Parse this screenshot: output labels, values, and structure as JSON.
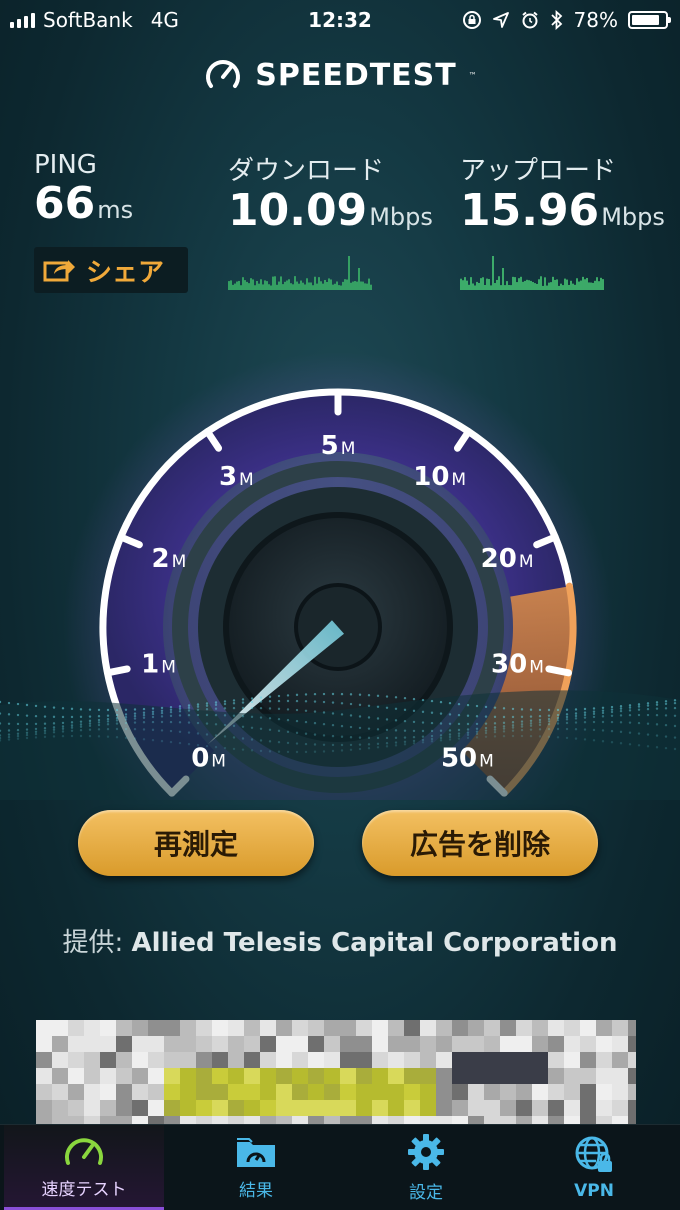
{
  "status_bar": {
    "carrier": "SoftBank",
    "network": "4G",
    "time": "12:32",
    "battery": "78%",
    "battery_level": 0.78,
    "icons": [
      "orientation-lock-icon",
      "location-icon",
      "alarm-icon",
      "bluetooth-icon"
    ]
  },
  "app": {
    "title": "SPEEDTEST",
    "trademark": "™"
  },
  "results": {
    "ping": {
      "label": "PING",
      "value": "66",
      "unit": "ms"
    },
    "download": {
      "label": "ダウンロード",
      "value": "10.09",
      "unit": "Mbps"
    },
    "upload": {
      "label": "アップロード",
      "value": "15.96",
      "unit": "Mbps"
    },
    "share_label": "シェア"
  },
  "gauge": {
    "scale": [
      {
        "n": "0",
        "u": "M"
      },
      {
        "n": "1",
        "u": "M"
      },
      {
        "n": "2",
        "u": "M"
      },
      {
        "n": "3",
        "u": "M"
      },
      {
        "n": "5",
        "u": "M"
      },
      {
        "n": "10",
        "u": "M"
      },
      {
        "n": "20",
        "u": "M"
      },
      {
        "n": "30",
        "u": "M"
      },
      {
        "n": "50",
        "u": "M"
      }
    ],
    "accent_purple": "#8b5bd6",
    "accent_orange": "#e08a3c"
  },
  "buttons": {
    "retest": "再測定",
    "remove_ads": "広告を削除"
  },
  "provider": {
    "prefix": "提供:",
    "name": "Allied Telesis Capital Corporation"
  },
  "tabs": [
    {
      "label": "速度テスト",
      "icon": "speedometer-icon",
      "active": true
    },
    {
      "label": "結果",
      "icon": "results-folder-icon",
      "active": false
    },
    {
      "label": "設定",
      "icon": "gear-icon",
      "active": false
    },
    {
      "label": "VPN",
      "icon": "vpn-globe-icon",
      "active": false
    }
  ]
}
